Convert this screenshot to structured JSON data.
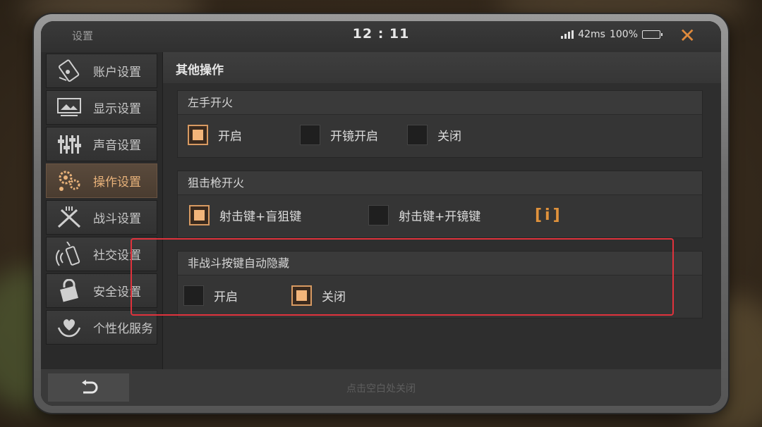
{
  "status": {
    "title": "设置",
    "time": "12 : 11",
    "ping": "42ms",
    "battery": "100%",
    "close_glyph": "✕"
  },
  "sidebar": {
    "items": [
      {
        "label": "账户设置",
        "icon": "account-phone-icon"
      },
      {
        "label": "显示设置",
        "icon": "display-monitor-icon"
      },
      {
        "label": "声音设置",
        "icon": "sound-sliders-icon"
      },
      {
        "label": "操作设置",
        "icon": "controls-gear-icon",
        "active": true
      },
      {
        "label": "战斗设置",
        "icon": "battle-guns-icon"
      },
      {
        "label": "社交设置",
        "icon": "social-radio-icon"
      },
      {
        "label": "安全设置",
        "icon": "security-lock-icon"
      },
      {
        "label": "个性化服务",
        "icon": "personalization-heart-icon"
      }
    ]
  },
  "main": {
    "title": "其他操作",
    "sections": [
      {
        "heading": "左手开火",
        "options": [
          {
            "label": "开启",
            "checked": true
          },
          {
            "label": "开镜开启",
            "checked": false
          },
          {
            "label": "关闭",
            "checked": false
          }
        ]
      },
      {
        "heading": "狙击枪开火",
        "options": [
          {
            "label": "射击键+盲狙键",
            "checked": true
          },
          {
            "label": "射击键+开镜键",
            "checked": false
          }
        ],
        "info": "[i]"
      },
      {
        "heading": "非战斗按键自动隐藏",
        "options": [
          {
            "label": "开启",
            "checked": false
          },
          {
            "label": "关闭",
            "checked": true
          }
        ]
      }
    ]
  },
  "bottom": {
    "hint": "点击空白处关闭",
    "back_glyph": "↶"
  },
  "colors": {
    "accent": "#f3b57a",
    "close": "#e08a3c",
    "highlight": "#e0323c"
  }
}
